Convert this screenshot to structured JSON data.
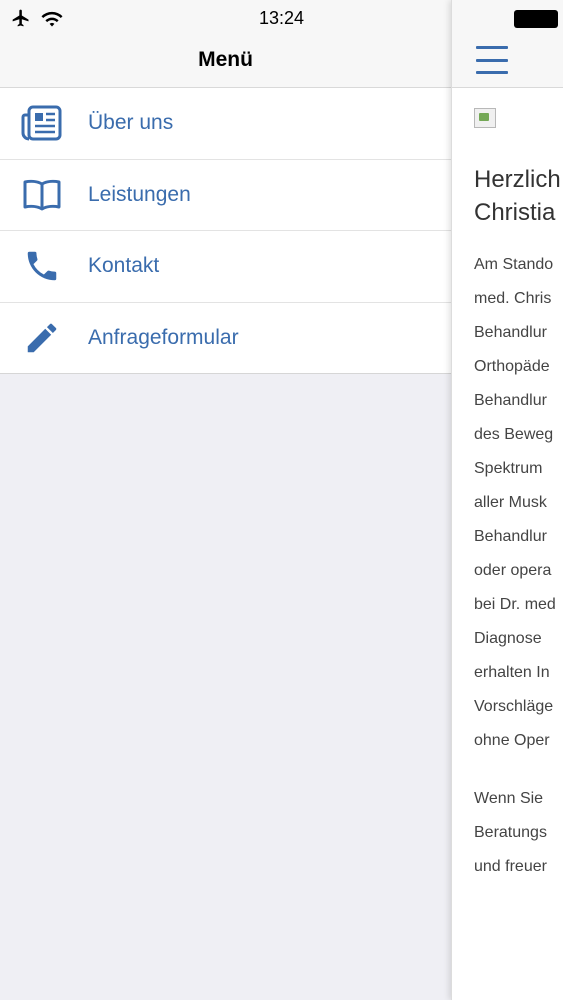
{
  "status_bar": {
    "time": "13:24"
  },
  "drawer": {
    "title": "Menü",
    "items": [
      {
        "label": "Über uns",
        "icon": "newspaper-icon"
      },
      {
        "label": "Leistungen",
        "icon": "book-icon"
      },
      {
        "label": "Kontakt",
        "icon": "phone-icon"
      },
      {
        "label": "Anfrageformular",
        "icon": "pencil-icon"
      }
    ]
  },
  "content": {
    "heading_lines": [
      "Herzlich",
      "Christia"
    ],
    "paragraph1": [
      "Am Stando",
      "med. Chris",
      "Behandlur",
      "Orthopäde",
      "Behandlur",
      "des Beweg",
      "Spektrum",
      "aller Musk",
      "Behandlur",
      "oder opera",
      "bei Dr. med",
      "Diagnose",
      "erhalten In",
      "Vorschläge",
      "ohne Oper"
    ],
    "paragraph2": [
      "Wenn Sie",
      "Beratungs",
      "und freuer"
    ]
  },
  "colors": {
    "accent": "#3a6cad",
    "bar_bg": "#f7f7f7",
    "drawer_bg": "#efeff4"
  }
}
